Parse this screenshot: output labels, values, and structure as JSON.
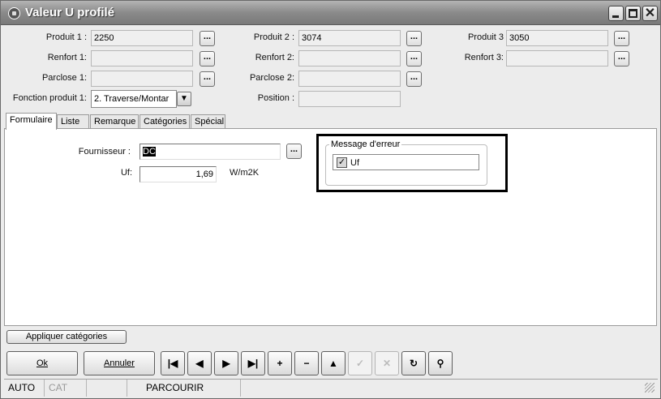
{
  "window": {
    "title": "Valeur U profilé"
  },
  "header": {
    "produit1": {
      "label": "Produit 1 :",
      "value": "2250"
    },
    "produit2": {
      "label": "Produit 2 :",
      "value": "3074"
    },
    "produit3": {
      "label": "Produit 3",
      "value": "3050"
    },
    "renfort1": {
      "label": "Renfort 1:",
      "value": ""
    },
    "renfort2": {
      "label": "Renfort 2:",
      "value": ""
    },
    "renfort3": {
      "label": "Renfort 3:",
      "value": ""
    },
    "parclose1": {
      "label": "Parclose 1:",
      "value": ""
    },
    "parclose2": {
      "label": "Parclose 2:",
      "value": ""
    },
    "fonction": {
      "label": "Fonction produit 1:",
      "value": "2. Traverse/Montar"
    },
    "position": {
      "label": "Position :",
      "value": ""
    },
    "lookup_label": "..."
  },
  "tabs": [
    "Formulaire",
    "Liste",
    "Remarque",
    "Catégories",
    "Spécial"
  ],
  "form": {
    "fournisseur": {
      "label": "Fournisseur :",
      "value": "DC"
    },
    "uf": {
      "label": "Uf:",
      "value": "1,69",
      "unit": "W/m2K"
    },
    "message_group": {
      "title": "Message d'erreur",
      "check_label": "Uf",
      "checked": true
    }
  },
  "buttons": {
    "appliquer": "Appliquer catégories",
    "ok": "Ok",
    "annuler": "Annuler"
  },
  "nav_icons": [
    "first-record-icon",
    "previous-record-icon",
    "next-record-icon",
    "last-record-icon",
    "add-icon",
    "remove-icon",
    "up-icon",
    "confirm-icon",
    "cancel-icon",
    "refresh-icon",
    "search-binoculars-icon"
  ],
  "status": {
    "mode": "AUTO",
    "cat": "CAT",
    "action": "PARCOURIR"
  }
}
